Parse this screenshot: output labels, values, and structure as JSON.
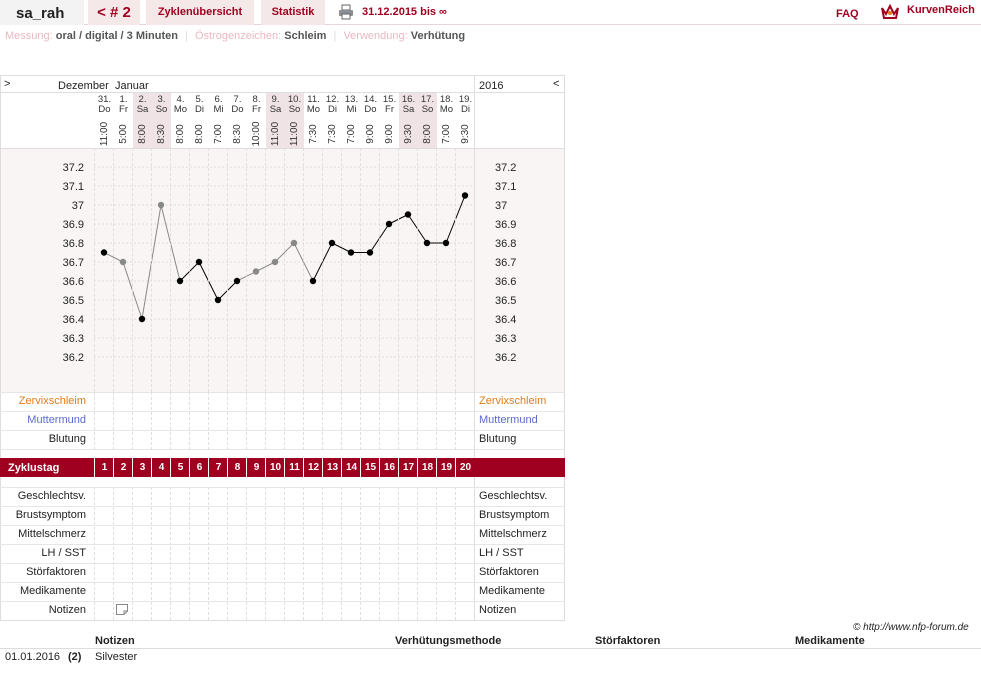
{
  "header": {
    "username": "sa_rah",
    "prev_cycle": "< # 2",
    "tab_cycle_overview": "Zyklenübersicht",
    "tab_statistics": "Statistik",
    "date_range": "31.12.2015 bis ∞",
    "faq": "FAQ",
    "brand": "KurvenReich",
    "colors": {
      "accent": "#a00020",
      "tab_bg": "#f5e8e8"
    }
  },
  "meta": {
    "measurement_label": "Messung:",
    "measurement_value": "oral / digital / 3 Minuten",
    "estrogen_label": "Östrogenzeichen:",
    "estrogen_value": "Schleim",
    "usage_label": "Verwendung:",
    "usage_value": "Verhütung"
  },
  "chart": {
    "nav_left": ">",
    "nav_right": "<",
    "month_1": "Dezember",
    "month_2": "Januar",
    "year": "2016",
    "days": [
      {
        "date": "31.",
        "dow": "Do",
        "time": "11:00",
        "weekend": false
      },
      {
        "date": "1.",
        "dow": "Fr",
        "time": "5:00",
        "weekend": false
      },
      {
        "date": "2.",
        "dow": "Sa",
        "time": "8:00",
        "weekend": true
      },
      {
        "date": "3.",
        "dow": "So",
        "time": "8:30",
        "weekend": true
      },
      {
        "date": "4.",
        "dow": "Mo",
        "time": "8:00",
        "weekend": false
      },
      {
        "date": "5.",
        "dow": "Di",
        "time": "8:00",
        "weekend": false
      },
      {
        "date": "6.",
        "dow": "Mi",
        "time": "7:00",
        "weekend": false
      },
      {
        "date": "7.",
        "dow": "Do",
        "time": "8:30",
        "weekend": false
      },
      {
        "date": "8.",
        "dow": "Fr",
        "time": "10:00",
        "weekend": false
      },
      {
        "date": "9.",
        "dow": "Sa",
        "time": "11:00",
        "weekend": true
      },
      {
        "date": "10.",
        "dow": "So",
        "time": "11:00",
        "weekend": true
      },
      {
        "date": "11.",
        "dow": "Mo",
        "time": "7:30",
        "weekend": false
      },
      {
        "date": "12.",
        "dow": "Di",
        "time": "7:30",
        "weekend": false
      },
      {
        "date": "13.",
        "dow": "Mi",
        "time": "7:00",
        "weekend": false
      },
      {
        "date": "14.",
        "dow": "Do",
        "time": "9:00",
        "weekend": false
      },
      {
        "date": "15.",
        "dow": "Fr",
        "time": "9:00",
        "weekend": false
      },
      {
        "date": "16.",
        "dow": "Sa",
        "time": "9:30",
        "weekend": true
      },
      {
        "date": "17.",
        "dow": "So",
        "time": "8:00",
        "weekend": true
      },
      {
        "date": "18.",
        "dow": "Mo",
        "time": "7:00",
        "weekend": false
      },
      {
        "date": "19.",
        "dow": "Di",
        "time": "9:30",
        "weekend": false
      }
    ],
    "temp_ticks": [
      "37.2",
      "37.1",
      "37",
      "36.9",
      "36.8",
      "36.7",
      "36.6",
      "36.5",
      "36.4",
      "36.3",
      "36.2"
    ],
    "row_labels": {
      "cervical": "Zervixschleim",
      "cervix": "Muttermund",
      "bleeding": "Blutung",
      "cycle_day": "Zyklustag",
      "sex": "Geschlechtsv.",
      "breast": "Brustsymptom",
      "midpain": "Mittelschmerz",
      "lh": "LH / SST",
      "disturb": "Störfaktoren",
      "meds": "Medikamente",
      "notes": "Notizen"
    },
    "cycle_days": [
      "1",
      "2",
      "3",
      "4",
      "5",
      "6",
      "7",
      "8",
      "9",
      "10",
      "11",
      "12",
      "13",
      "14",
      "15",
      "16",
      "17",
      "18",
      "19",
      "20"
    ]
  },
  "chart_data": {
    "type": "line",
    "x": [
      1,
      2,
      3,
      4,
      5,
      6,
      7,
      8,
      9,
      10,
      11,
      12,
      13,
      14,
      15,
      16,
      17,
      18,
      19
    ],
    "values": [
      36.75,
      36.7,
      36.4,
      37.0,
      36.6,
      36.7,
      36.5,
      36.6,
      36.65,
      36.7,
      36.8,
      36.6,
      36.8,
      36.75,
      36.75,
      36.9,
      36.95,
      36.8,
      36.8,
      37.05
    ],
    "disturbed": [
      false,
      true,
      false,
      true,
      false,
      false,
      false,
      false,
      true,
      true,
      true,
      false,
      false,
      false,
      false,
      false,
      false,
      false,
      false,
      false
    ],
    "ylim": [
      36.1,
      37.3
    ],
    "colors": {
      "normal": "#000000",
      "disturbed": "#888888"
    }
  },
  "footer": {
    "copyright": "© http://www.nfp-forum.de",
    "col_notes": "Notizen",
    "col_method": "Verhütungsmethode",
    "col_disturb": "Störfaktoren",
    "col_meds": "Medikamente",
    "row_date": "01.01.2016",
    "row_day": "(2)",
    "row_note": "Silvester"
  }
}
